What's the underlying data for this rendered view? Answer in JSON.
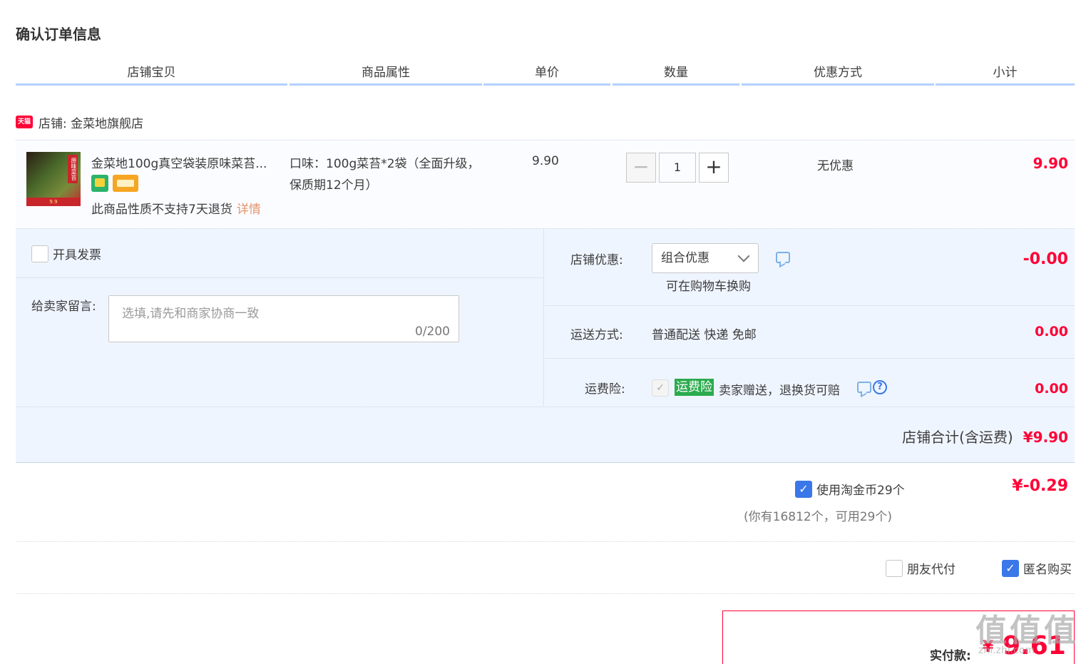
{
  "page": {
    "title": "确认订单信息"
  },
  "columns": [
    "店铺宝贝",
    "商品属性",
    "单价",
    "数量",
    "优惠方式",
    "小计"
  ],
  "shop": {
    "badge": "天猫",
    "label": "店铺: 金菜地旗舰店"
  },
  "item": {
    "title": "金菜地100g真空袋装原味菜苔...",
    "thumb_label": "原味菜苔",
    "thumb_promo": "9.9",
    "attribute": "口味：100g菜苔*2袋（全面升级，保质期12个月）",
    "price": "9.90",
    "quantity": "1",
    "qty_minus": "−",
    "qty_plus": "+",
    "promotion": "无优惠",
    "subtotal": "9.90",
    "no_return_text": "此商品性质不支持7天退货",
    "details_link": "详情"
  },
  "options": {
    "invoice_label": "开具发票",
    "message_label": "给卖家留言:",
    "message_placeholder": "选填,请先和商家协商一致",
    "message_count": "0/200",
    "shop_discount_label": "店铺优惠:",
    "shop_discount_value": "组合优惠",
    "shop_discount_note": "可在购物车换购",
    "shop_discount_amount": "-0.00",
    "shipping_label": "运送方式:",
    "shipping_value": "普通配送 快递 免邮",
    "shipping_amount": "0.00",
    "insurance_label": "运费险:",
    "insurance_tag": "运费险",
    "insurance_text": "卖家赠送，退换货可赔",
    "insurance_amount": "0.00",
    "insurance_help": "?"
  },
  "shop_total": {
    "label": "店铺合计(含运费)",
    "amount": "¥9.90"
  },
  "coins": {
    "label": "使用淘金币29个",
    "note": "(你有16812个，可用29个)",
    "amount": "¥-0.29",
    "checked": true
  },
  "pay_options": {
    "friend_pay": "朋友代付",
    "anonymous": "匿名购买"
  },
  "final": {
    "label": "实付款:",
    "currency": "¥",
    "amount": "9.61"
  },
  "watermark": {
    "logo": "值",
    "site": "zhi.zhi.com"
  },
  "colors": {
    "accent_red": "#ff0036",
    "header_line": "#b2d1ff",
    "option_bg": "#eff5ff",
    "checkbox_blue": "#3a77e8"
  }
}
